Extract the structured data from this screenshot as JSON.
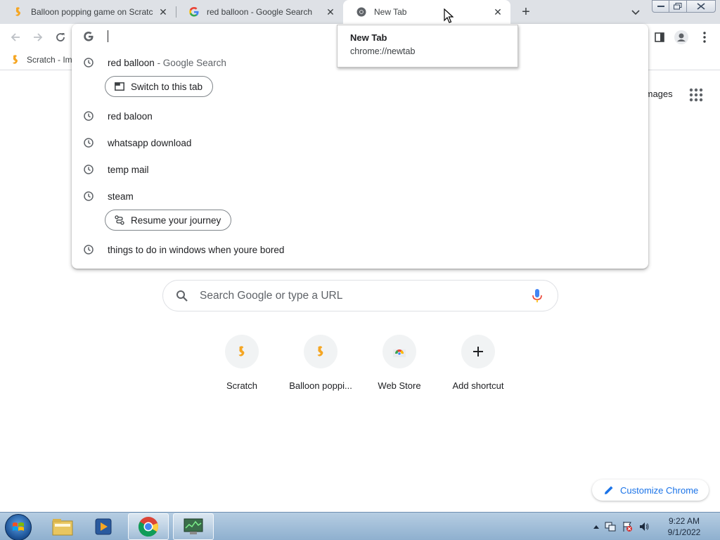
{
  "tabs": [
    {
      "title": "Balloon popping game on Scratch",
      "favicon": "scratch-icon"
    },
    {
      "title": "red balloon - Google Search",
      "favicon": "google-icon"
    },
    {
      "title": "New Tab",
      "favicon": "chrome-icon",
      "active": true
    }
  ],
  "tooltip": {
    "title": "New Tab",
    "url": "chrome://newtab"
  },
  "omnibox": {
    "value": "",
    "suggestions": [
      {
        "text": "red balloon",
        "sub": " - Google Search",
        "icon": "history-clock-icon"
      },
      {
        "text": "red baloon",
        "icon": "history-clock-icon"
      },
      {
        "text": "whatsapp download",
        "icon": "history-clock-icon"
      },
      {
        "text": "temp mail",
        "icon": "history-clock-icon"
      },
      {
        "text": "steam",
        "icon": "history-clock-icon"
      },
      {
        "text": "things to do in windows when youre bored",
        "icon": "history-clock-icon"
      }
    ],
    "switch_tab_label": "Switch to this tab",
    "resume_journey_label": "Resume your journey"
  },
  "bookmarks": [
    {
      "label": "Scratch - Im",
      "favicon": "scratch-icon"
    }
  ],
  "page": {
    "images_link": "Images",
    "search_placeholder": "Search Google or type a URL",
    "shortcuts": [
      {
        "label": "Scratch",
        "icon": "scratch-icon"
      },
      {
        "label": "Balloon poppi...",
        "icon": "scratch-icon"
      },
      {
        "label": "Web Store",
        "icon": "chrome-web-store-icon"
      },
      {
        "label": "Add shortcut",
        "icon": "plus-icon"
      }
    ],
    "customize_label": "Customize Chrome"
  },
  "taskbar": {
    "clock_time": "9:22 AM",
    "clock_date": "9/1/2022",
    "apps": [
      "windows-explorer-icon",
      "media-player-icon",
      "chrome-icon",
      "task-manager-icon"
    ]
  },
  "colors": {
    "accent": "#1a73e8",
    "tabstrip": "#dee1e6",
    "scratch": "#f5a623"
  }
}
